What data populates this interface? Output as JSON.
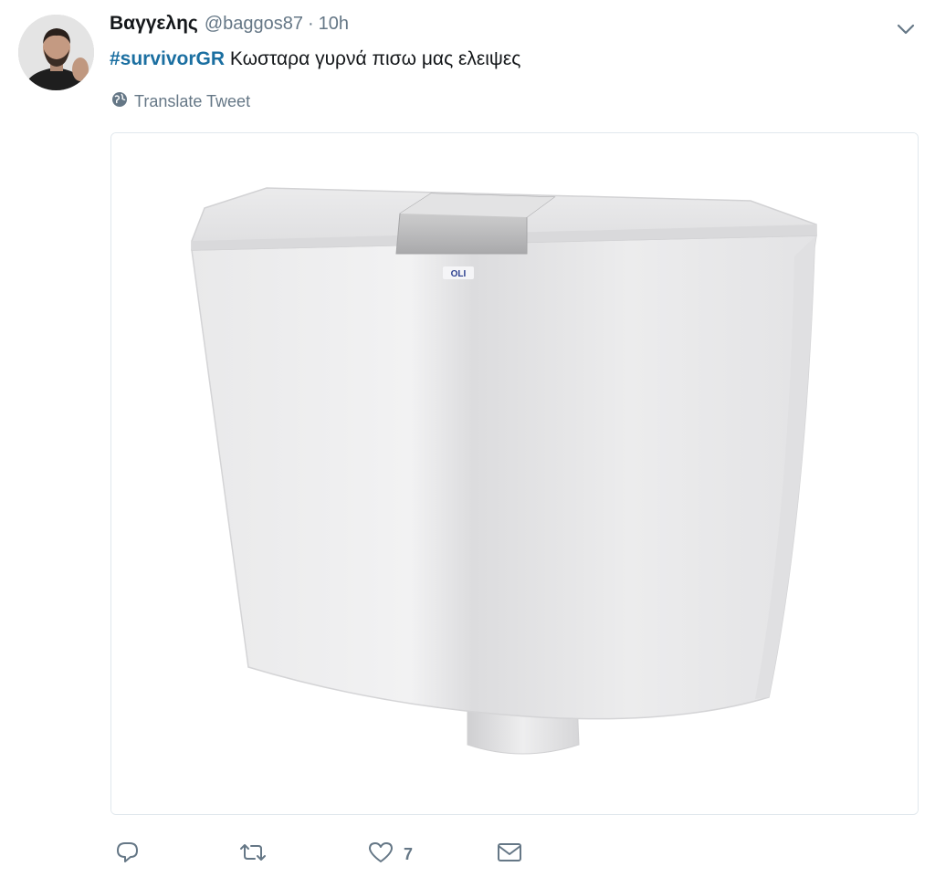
{
  "tweet": {
    "author_name": "Βαγγελης",
    "author_handle": "@baggos87",
    "separator": "·",
    "time": "10h",
    "hashtag": "#survivorGR",
    "text": "Κωσταρα γυρνά πισω μας ελειψες",
    "translate_label": "Translate Tweet"
  },
  "media": {
    "label_on_tank": "OLI"
  },
  "actions": {
    "reply_count": "",
    "retweet_count": "",
    "like_count": "7",
    "message_count": ""
  },
  "icons": {
    "more": "chevron-down-icon",
    "translate": "globe-icon",
    "reply": "reply-icon",
    "retweet": "retweet-icon",
    "like": "heart-icon",
    "dm": "envelope-icon"
  },
  "colors": {
    "hashtag": "#1b6fa1",
    "muted": "#657786",
    "text": "#14171a"
  }
}
